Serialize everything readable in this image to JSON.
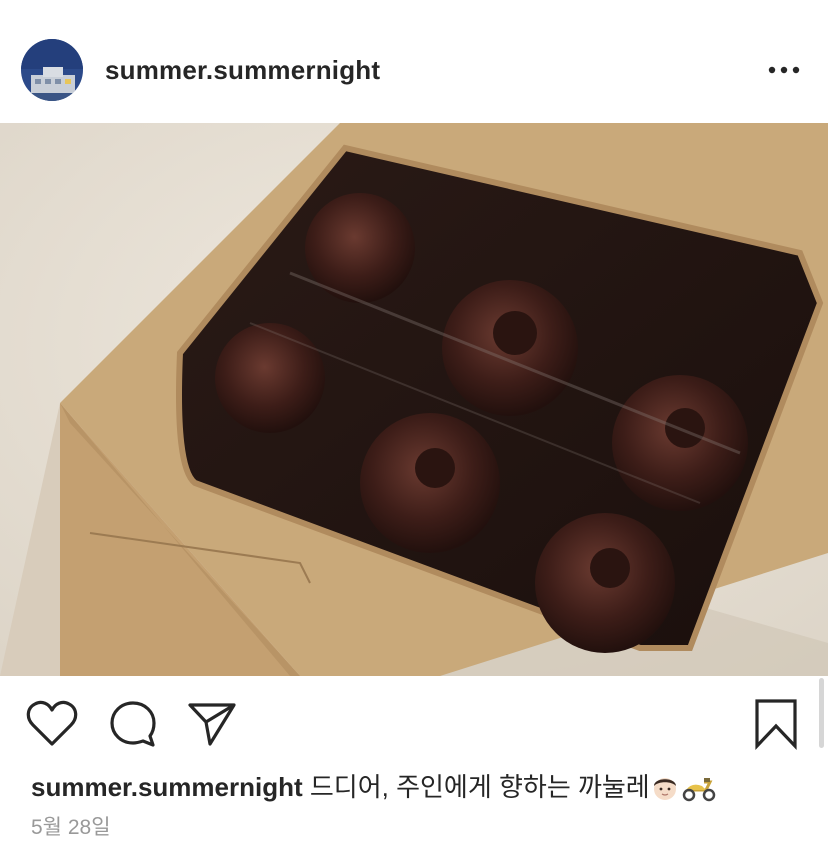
{
  "post": {
    "username": "summer.summernight",
    "caption_user": "summer.summernight",
    "caption_text": "드디어, 주인에게 향하는 까눌레",
    "caption_emojis": [
      "man-face-icon",
      "scooter-icon"
    ],
    "date": "5월 28일"
  },
  "icons": {
    "more": "more-dots-icon",
    "like": "heart-icon",
    "comment": "comment-bubble-icon",
    "share": "paper-plane-icon",
    "save": "bookmark-icon"
  },
  "colors": {
    "text": "#262626",
    "muted": "#999999",
    "kraft_box": "#c9a97a",
    "background": "#ffffff"
  }
}
